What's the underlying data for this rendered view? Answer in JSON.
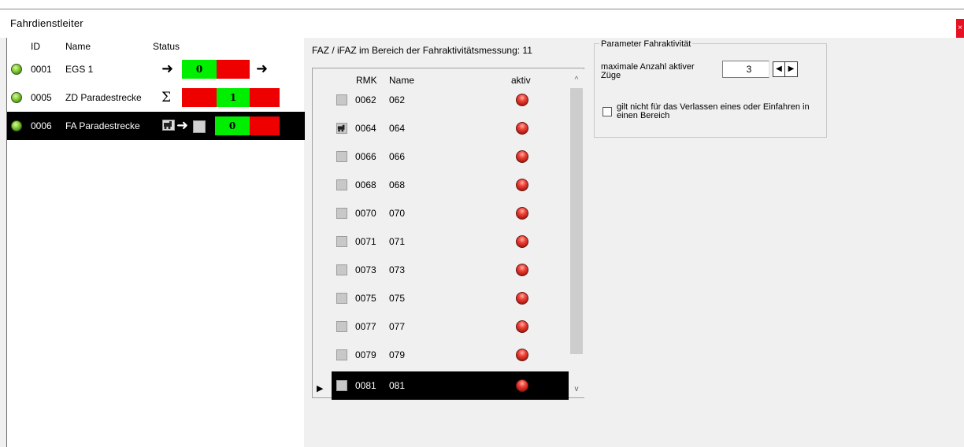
{
  "window": {
    "title": "Fahrdienstleiter",
    "close_glyph": "×"
  },
  "left": {
    "headers": {
      "id": "ID",
      "name": "Name",
      "status": "Status"
    },
    "rows": [
      {
        "id": "0001",
        "name": "EGS 1",
        "count": "0",
        "status_icons": [
          "arrow-right-icon",
          "arrow-right-icon"
        ]
      },
      {
        "id": "0005",
        "name": "ZD Paradestrecke",
        "count": "1",
        "status_icons": [
          "sigma-icon"
        ]
      },
      {
        "id": "0006",
        "name": "FA Paradestrecke",
        "count": "0",
        "status_icons": [
          "loco-icon",
          "arrow-right-icon"
        ],
        "selected": true
      }
    ]
  },
  "faz": {
    "label": "FAZ / iFAZ im Bereich der Fahraktivitätsmessung: 11",
    "headers": {
      "rmk": "RMK",
      "name": "Name",
      "active": "aktiv"
    },
    "rows": [
      {
        "rmk": "0062",
        "name": "062"
      },
      {
        "rmk": "0064",
        "name": "064",
        "loco": true
      },
      {
        "rmk": "0066",
        "name": "066"
      },
      {
        "rmk": "0068",
        "name": "068"
      },
      {
        "rmk": "0070",
        "name": "070"
      },
      {
        "rmk": "0071",
        "name": "071"
      },
      {
        "rmk": "0073",
        "name": "073"
      },
      {
        "rmk": "0075",
        "name": "075"
      },
      {
        "rmk": "0077",
        "name": "077"
      },
      {
        "rmk": "0079",
        "name": "079"
      },
      {
        "rmk": "0081",
        "name": "081",
        "selected": true
      }
    ],
    "scroll_up_glyph": "^",
    "scroll_down_glyph": "v",
    "current_row_glyph": "▶"
  },
  "params": {
    "title": "Parameter Fahraktivität",
    "max_label": "maximale Anzahl aktiver Züge",
    "max_value": "3",
    "spin_left_glyph": "◀",
    "spin_right_glyph": "▶",
    "checkbox_label": "gilt nicht für das Verlassen eines oder Einfahren in einen Bereich",
    "checkbox_checked": false
  },
  "colors": {
    "green": "#00ee00",
    "red": "#ee0000",
    "selection": "#000000",
    "led_green": "#8ccf3a",
    "led_red": "#e0302a"
  }
}
